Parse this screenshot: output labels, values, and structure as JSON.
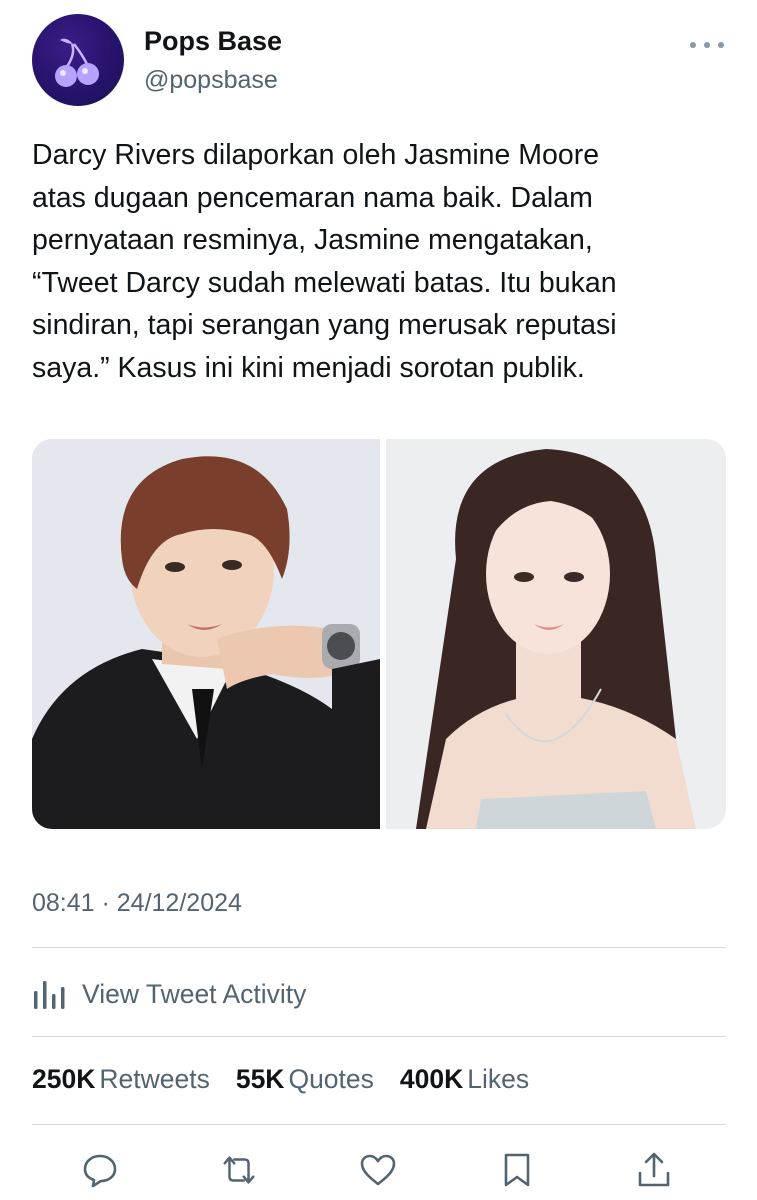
{
  "user": {
    "display_name": "Pops Base",
    "handle": "@popsbase",
    "avatar_icon": "cherry-icon"
  },
  "tweet": {
    "text": "Darcy Rivers dilaporkan oleh Jasmine Moore\natas dugaan pencemaran nama baik. Dalam\npernyataan resminya, Jasmine mengatakan,\n“Tweet Darcy sudah melewati batas. Itu bukan\nsindiran, tapi serangan yang merusak reputasi\nsaya.” Kasus ini kini menjadi sorotan publik.",
    "timestamp": "08:41 · 24/12/2024"
  },
  "activity": {
    "label": "View Tweet Activity",
    "icon": "bar-chart-icon"
  },
  "stats": {
    "retweets_count": "250K",
    "retweets_label": "Retweets",
    "quotes_count": "55K",
    "quotes_label": "Quotes",
    "likes_count": "400K",
    "likes_label": "Likes"
  },
  "actions": [
    "reply-icon",
    "retweet-icon",
    "like-icon",
    "bookmark-icon",
    "share-icon"
  ],
  "colors": {
    "text": "#0f1419",
    "secondary": "#536471",
    "icon": "#536471",
    "divider": "#d5dadf",
    "avatar_bg": "#2a1470"
  }
}
